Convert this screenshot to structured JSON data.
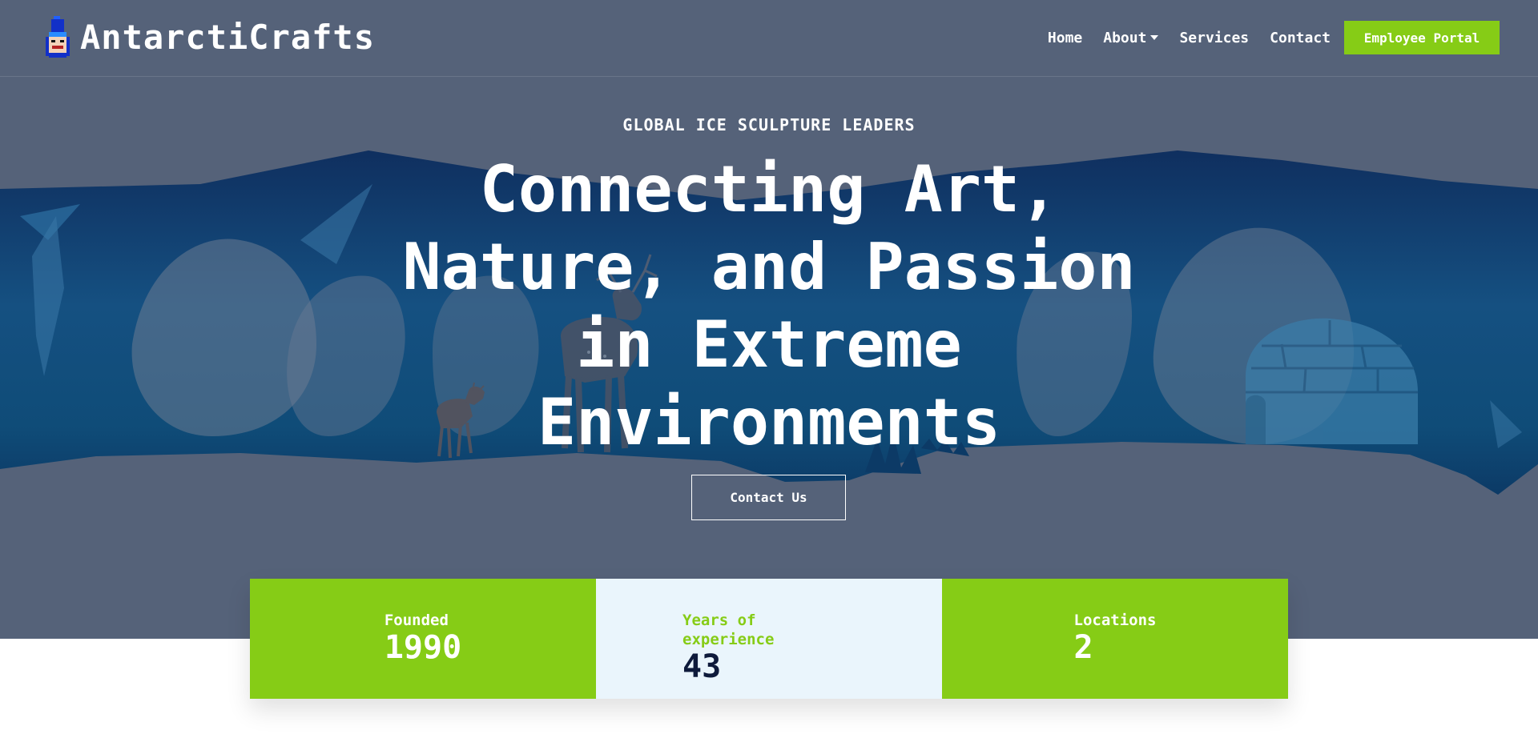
{
  "brand": {
    "name": "AntarctiCrafts",
    "logo_icon": "nutcracker-logo-icon"
  },
  "nav": {
    "home": "Home",
    "about": "About",
    "services": "Services",
    "contact": "Contact",
    "portal": "Employee Portal"
  },
  "hero": {
    "eyebrow": "GLOBAL ICE SCULPTURE LEADERS",
    "headline": "Connecting Art, Nature, and Passion in Extreme Environments",
    "cta": "Contact Us",
    "illustration_icons": [
      "ice-cave-illustration",
      "deer-icon",
      "fawn-icon",
      "igloo-icon"
    ]
  },
  "stats": [
    {
      "label": "Founded",
      "value": "1990"
    },
    {
      "label": "Years of experience",
      "value": "43"
    },
    {
      "label": "Locations",
      "value": "2"
    }
  ],
  "colors": {
    "hero_overlay": "#556279",
    "accent_green": "#86cc16",
    "stat_light": "#eaf5fc",
    "navy_text": "#0e1a3b"
  }
}
